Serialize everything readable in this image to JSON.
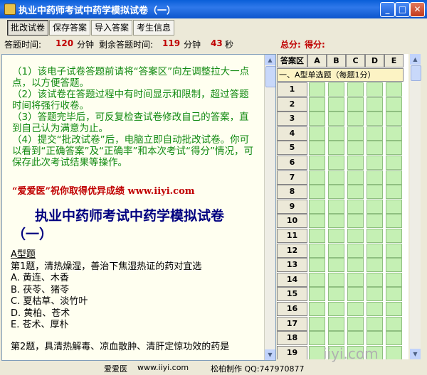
{
  "window": {
    "title": "执业中药师考试中药学模拟试卷（一）",
    "minimize_glyph": "_",
    "maximize_glyph": "□",
    "close_glyph": "✕"
  },
  "toolbar": {
    "grade_label": "批改试卷",
    "save_label": "保存答案",
    "import_label": "导入答案",
    "info_label": "考生信息"
  },
  "status": {
    "exam_time_label": "答题时间:",
    "exam_time_value": "120",
    "exam_time_unit": "分钟",
    "remaining_label": "剩余答题时间:",
    "remaining_minutes": "119",
    "remaining_min_unit": "分钟",
    "remaining_seconds": "43",
    "remaining_sec_unit": "秒",
    "total_score_label": "总分:",
    "score_label": "得分:"
  },
  "instructions": [
    "（1）该电子试卷答题前请将“答案区”向左调整拉大一点点，以方便答题。",
    "（2）该试卷在答题过程中有时间显示和限制，超过答题时间将强行收卷。",
    "（3）答题完毕后，可反复检查试卷修改自己的答案，直到自己认为满意为止。",
    "（4）提交“批改试卷”后，电脑立即自动批改试卷。你可以看到“正确答案”及“正确率”和本次考试“得分”情况，可保存此次考试结果等操作。"
  ],
  "greeting": "“爱爱医”祝你取得优异成绩 www.iiyi.com",
  "paper_title": "执业中药师考试中药学模拟试卷（一）",
  "question": {
    "type": "A型题",
    "stem": "第1题，清热燥湿，善治下焦湿热证的药对宜选",
    "options": [
      "A. 黄连、木香",
      "B. 茯苓、猪苓",
      "C. 夏枯草、淡竹叶",
      "D. 黄柏、苍术",
      "E. 苍术、厚朴"
    ],
    "next_partial": "第2题，具清热解毒、凉血散肿、清肝定惊功效的药是"
  },
  "answer_area": {
    "header": "答案区",
    "columns": [
      "A",
      "B",
      "C",
      "D",
      "E"
    ],
    "section": "一、A型单选题（每题1分）",
    "rows": [
      "1",
      "2",
      "3",
      "4",
      "5",
      "6",
      "7",
      "8",
      "9",
      "10",
      "11",
      "12",
      "13",
      "14",
      "15",
      "16",
      "17",
      "18",
      "19"
    ]
  },
  "footer": {
    "site_name": "爱爱医",
    "site_url": "www.iiyi.com",
    "credit": "松柏制作 QQ:747970877"
  },
  "watermark": "iiyi.com",
  "colors": {
    "title_bar": "#2f78ea",
    "instruction_text": "#118a11",
    "highlight_red": "#c00000",
    "paper_title": "#000080",
    "answer_cell": "#c5f0b4",
    "section_bg": "#fcf3c4"
  }
}
